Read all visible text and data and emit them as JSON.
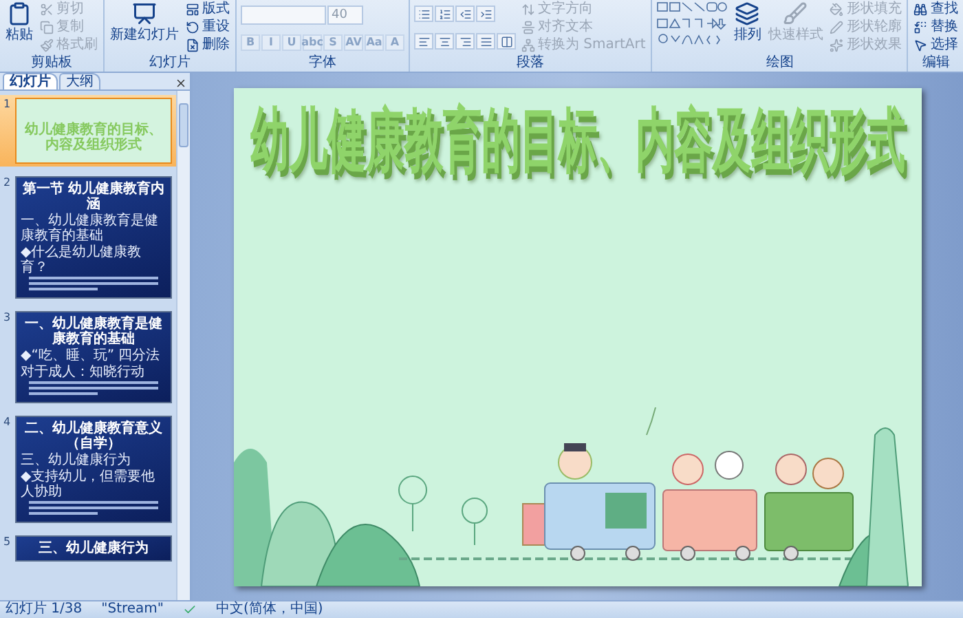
{
  "ribbon": {
    "groups": [
      {
        "kind": "clipboard",
        "label": "剪贴板",
        "large": [
          {
            "label": "粘贴",
            "disabled": false
          }
        ],
        "small": [
          {
            "label": "剪切",
            "disabled": true
          },
          {
            "label": "复制",
            "disabled": true
          },
          {
            "label": "格式刷",
            "disabled": true
          }
        ]
      },
      {
        "kind": "slides",
        "label": "幻灯片",
        "large": [
          {
            "label": "新建幻灯片",
            "disabled": false
          }
        ],
        "small": [
          {
            "label": "版式",
            "disabled": false
          },
          {
            "label": "重设",
            "disabled": false
          },
          {
            "label": "删除",
            "disabled": false
          }
        ]
      },
      {
        "kind": "font",
        "label": "字体",
        "font_size": "40",
        "format_buttons": [
          {
            "label": "B",
            "disabled": true
          },
          {
            "label": "I",
            "disabled": true
          },
          {
            "label": "U",
            "disabled": true
          },
          {
            "label": "abc",
            "disabled": true
          },
          {
            "label": "S",
            "disabled": true
          },
          {
            "label": "AV",
            "disabled": true
          },
          {
            "label": "Aa",
            "disabled": true
          },
          {
            "label": "A",
            "disabled": true
          }
        ]
      },
      {
        "kind": "paragraph",
        "label": "段落",
        "small": [
          {
            "label": "文字方向",
            "disabled": true
          },
          {
            "label": "对齐文本",
            "disabled": true
          },
          {
            "label": "转换为 SmartArt",
            "disabled": true
          }
        ]
      },
      {
        "kind": "drawing",
        "label": "绘图",
        "large": [
          {
            "label": "排列",
            "disabled": false
          },
          {
            "label": "快速样式",
            "disabled": true
          }
        ],
        "small": [
          {
            "label": "形状填充",
            "disabled": true
          },
          {
            "label": "形状轮廓",
            "disabled": true
          },
          {
            "label": "形状效果",
            "disabled": true
          }
        ]
      },
      {
        "kind": "editing",
        "label": "编辑",
        "small": [
          {
            "label": "查找",
            "disabled": false
          },
          {
            "label": "替换",
            "disabled": false
          },
          {
            "label": "选择",
            "disabled": false
          }
        ]
      }
    ]
  },
  "pane_tabs": [
    {
      "label": "幻灯片",
      "selected": true
    },
    {
      "label": "大纲",
      "selected": false
    }
  ],
  "slides": [
    {
      "number": "1",
      "selected": true,
      "kind": "title",
      "title": "幼儿健康教育的目标、内容及组织形式"
    },
    {
      "number": "2",
      "selected": false,
      "kind": "content",
      "title": "第一节 幼儿健康教育内涵",
      "lines": [
        "一、幼儿健康教育是健康教育的基础",
        "◆什么是幼儿健康教育？"
      ]
    },
    {
      "number": "3",
      "selected": false,
      "kind": "content",
      "title": "一、幼儿健康教育是健康教育的基础",
      "lines": [
        "◆“吃、睡、玩” 四分法",
        "对于成人：知晓行动"
      ]
    },
    {
      "number": "4",
      "selected": false,
      "kind": "content",
      "title": "二、幼儿健康教育意义（自学）",
      "lines": [
        "三、幼儿健康行为",
        "◆支持幼儿，但需要他人协助"
      ]
    },
    {
      "number": "5",
      "selected": false,
      "kind": "content",
      "title": "三、幼儿健康行为"
    }
  ],
  "current_slide": {
    "title": "幼儿健康教育的目标、内容及组织形式"
  },
  "status_bar": {
    "slide": "幻灯片 1/38",
    "theme": "\"Stream\"",
    "language": "中文(简体，中国)"
  }
}
